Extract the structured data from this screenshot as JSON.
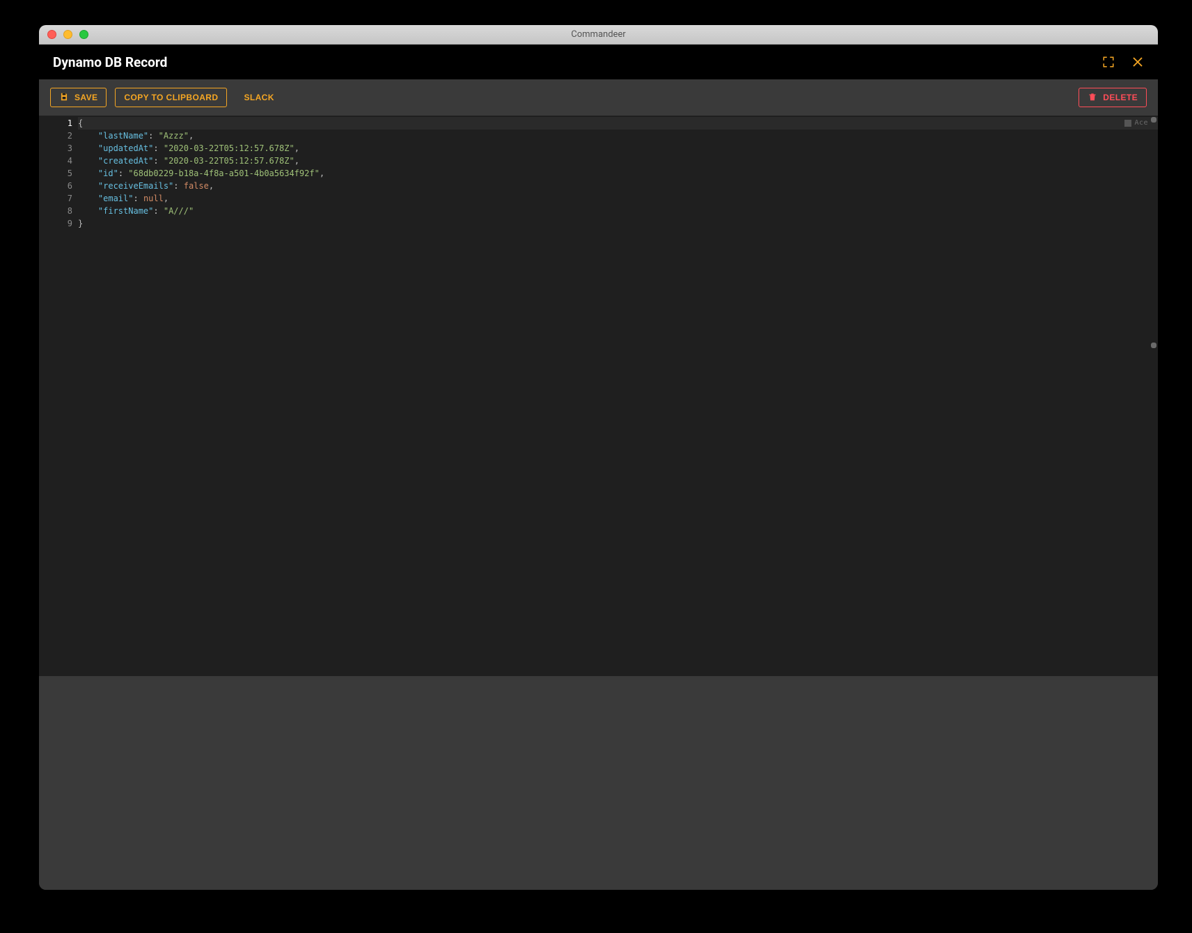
{
  "app_window_title": "Commandeer",
  "header": {
    "title": "Dynamo DB Record"
  },
  "toolbar": {
    "save_label": "SAVE",
    "copy_label": "COPY TO CLIPBOARD",
    "slack_label": "SLACK",
    "delete_label": "DELETE"
  },
  "editor": {
    "line_numbers": [
      "1",
      "2",
      "3",
      "4",
      "5",
      "6",
      "7",
      "8",
      "9"
    ],
    "lines": [
      {
        "type": "brace",
        "text": "{"
      },
      {
        "type": "kv",
        "key": "lastName",
        "valueType": "string",
        "value": "Azzz",
        "comma": true
      },
      {
        "type": "kv",
        "key": "updatedAt",
        "valueType": "string",
        "value": "2020-03-22T05:12:57.678Z",
        "comma": true
      },
      {
        "type": "kv",
        "key": "createdAt",
        "valueType": "string",
        "value": "2020-03-22T05:12:57.678Z",
        "comma": true
      },
      {
        "type": "kv",
        "key": "id",
        "valueType": "string",
        "value": "68db0229-b18a-4f8a-a501-4b0a5634f92f",
        "comma": true
      },
      {
        "type": "kv",
        "key": "receiveEmails",
        "valueType": "boolean",
        "value": "false",
        "comma": true
      },
      {
        "type": "kv",
        "key": "email",
        "valueType": "null",
        "value": "null",
        "comma": true
      },
      {
        "type": "kv",
        "key": "firstName",
        "valueType": "string",
        "value": "A///",
        "comma": false
      },
      {
        "type": "brace",
        "text": "}"
      }
    ],
    "ace_badge": "Ace"
  },
  "colors": {
    "accent_orange": "#f5a623",
    "accent_red": "#ff4d58",
    "editor_bg": "#1f1f1f",
    "panel_bg": "#3a3a3a"
  }
}
